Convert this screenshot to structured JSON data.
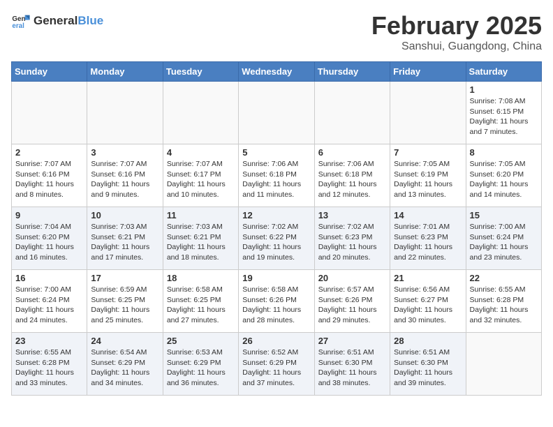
{
  "logo": {
    "general": "General",
    "blue": "Blue"
  },
  "title": "February 2025",
  "subtitle": "Sanshui, Guangdong, China",
  "days_of_week": [
    "Sunday",
    "Monday",
    "Tuesday",
    "Wednesday",
    "Thursday",
    "Friday",
    "Saturday"
  ],
  "weeks": [
    [
      {
        "day": "",
        "detail": ""
      },
      {
        "day": "",
        "detail": ""
      },
      {
        "day": "",
        "detail": ""
      },
      {
        "day": "",
        "detail": ""
      },
      {
        "day": "",
        "detail": ""
      },
      {
        "day": "",
        "detail": ""
      },
      {
        "day": "1",
        "detail": "Sunrise: 7:08 AM\nSunset: 6:15 PM\nDaylight: 11 hours\nand 7 minutes."
      }
    ],
    [
      {
        "day": "2",
        "detail": "Sunrise: 7:07 AM\nSunset: 6:16 PM\nDaylight: 11 hours\nand 8 minutes."
      },
      {
        "day": "3",
        "detail": "Sunrise: 7:07 AM\nSunset: 6:16 PM\nDaylight: 11 hours\nand 9 minutes."
      },
      {
        "day": "4",
        "detail": "Sunrise: 7:07 AM\nSunset: 6:17 PM\nDaylight: 11 hours\nand 10 minutes."
      },
      {
        "day": "5",
        "detail": "Sunrise: 7:06 AM\nSunset: 6:18 PM\nDaylight: 11 hours\nand 11 minutes."
      },
      {
        "day": "6",
        "detail": "Sunrise: 7:06 AM\nSunset: 6:18 PM\nDaylight: 11 hours\nand 12 minutes."
      },
      {
        "day": "7",
        "detail": "Sunrise: 7:05 AM\nSunset: 6:19 PM\nDaylight: 11 hours\nand 13 minutes."
      },
      {
        "day": "8",
        "detail": "Sunrise: 7:05 AM\nSunset: 6:20 PM\nDaylight: 11 hours\nand 14 minutes."
      }
    ],
    [
      {
        "day": "9",
        "detail": "Sunrise: 7:04 AM\nSunset: 6:20 PM\nDaylight: 11 hours\nand 16 minutes."
      },
      {
        "day": "10",
        "detail": "Sunrise: 7:03 AM\nSunset: 6:21 PM\nDaylight: 11 hours\nand 17 minutes."
      },
      {
        "day": "11",
        "detail": "Sunrise: 7:03 AM\nSunset: 6:21 PM\nDaylight: 11 hours\nand 18 minutes."
      },
      {
        "day": "12",
        "detail": "Sunrise: 7:02 AM\nSunset: 6:22 PM\nDaylight: 11 hours\nand 19 minutes."
      },
      {
        "day": "13",
        "detail": "Sunrise: 7:02 AM\nSunset: 6:23 PM\nDaylight: 11 hours\nand 20 minutes."
      },
      {
        "day": "14",
        "detail": "Sunrise: 7:01 AM\nSunset: 6:23 PM\nDaylight: 11 hours\nand 22 minutes."
      },
      {
        "day": "15",
        "detail": "Sunrise: 7:00 AM\nSunset: 6:24 PM\nDaylight: 11 hours\nand 23 minutes."
      }
    ],
    [
      {
        "day": "16",
        "detail": "Sunrise: 7:00 AM\nSunset: 6:24 PM\nDaylight: 11 hours\nand 24 minutes."
      },
      {
        "day": "17",
        "detail": "Sunrise: 6:59 AM\nSunset: 6:25 PM\nDaylight: 11 hours\nand 25 minutes."
      },
      {
        "day": "18",
        "detail": "Sunrise: 6:58 AM\nSunset: 6:25 PM\nDaylight: 11 hours\nand 27 minutes."
      },
      {
        "day": "19",
        "detail": "Sunrise: 6:58 AM\nSunset: 6:26 PM\nDaylight: 11 hours\nand 28 minutes."
      },
      {
        "day": "20",
        "detail": "Sunrise: 6:57 AM\nSunset: 6:26 PM\nDaylight: 11 hours\nand 29 minutes."
      },
      {
        "day": "21",
        "detail": "Sunrise: 6:56 AM\nSunset: 6:27 PM\nDaylight: 11 hours\nand 30 minutes."
      },
      {
        "day": "22",
        "detail": "Sunrise: 6:55 AM\nSunset: 6:28 PM\nDaylight: 11 hours\nand 32 minutes."
      }
    ],
    [
      {
        "day": "23",
        "detail": "Sunrise: 6:55 AM\nSunset: 6:28 PM\nDaylight: 11 hours\nand 33 minutes."
      },
      {
        "day": "24",
        "detail": "Sunrise: 6:54 AM\nSunset: 6:29 PM\nDaylight: 11 hours\nand 34 minutes."
      },
      {
        "day": "25",
        "detail": "Sunrise: 6:53 AM\nSunset: 6:29 PM\nDaylight: 11 hours\nand 36 minutes."
      },
      {
        "day": "26",
        "detail": "Sunrise: 6:52 AM\nSunset: 6:29 PM\nDaylight: 11 hours\nand 37 minutes."
      },
      {
        "day": "27",
        "detail": "Sunrise: 6:51 AM\nSunset: 6:30 PM\nDaylight: 11 hours\nand 38 minutes."
      },
      {
        "day": "28",
        "detail": "Sunrise: 6:51 AM\nSunset: 6:30 PM\nDaylight: 11 hours\nand 39 minutes."
      },
      {
        "day": "",
        "detail": ""
      }
    ]
  ]
}
